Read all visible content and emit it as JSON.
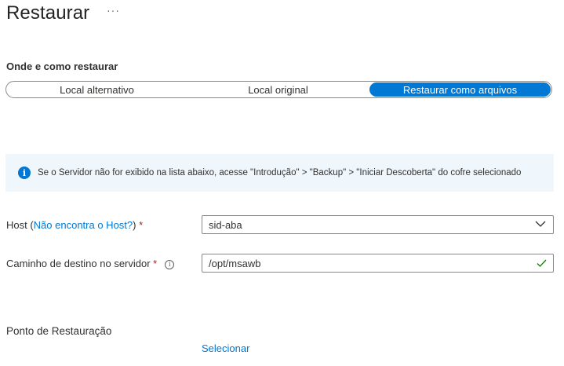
{
  "header": {
    "title": "Restaurar",
    "more_label": "···"
  },
  "restore_location": {
    "section_title": "Onde e como restaurar",
    "options": [
      "Local alternativo",
      "Local original",
      "Restaurar como arquivos"
    ],
    "selected": "Restaurar como arquivos"
  },
  "info_banner": {
    "icon": "info-icon",
    "icon_glyph": "i",
    "text": "Se o Servidor não for exibido na lista abaixo, acesse \"Introdução\" > \"Backup\" > \"Iniciar Descoberta\" do cofre selecionado"
  },
  "host_field": {
    "label": "Host (",
    "link_text": "Não encontra o Host?",
    "label_end": ") ",
    "required_marker": "*",
    "value": "sid-aba"
  },
  "destination_field": {
    "label": "Caminho de destino no servidor ",
    "required_marker": "*",
    "help_glyph": "i",
    "value": "/opt/msawb"
  },
  "restore_point": {
    "title": "Ponto de Restauração",
    "select_link": "Selecionar"
  },
  "colors": {
    "accent": "#0078d4",
    "required": "#a4262c",
    "valid_check": "#107c10",
    "info_background": "#eff6fc"
  }
}
